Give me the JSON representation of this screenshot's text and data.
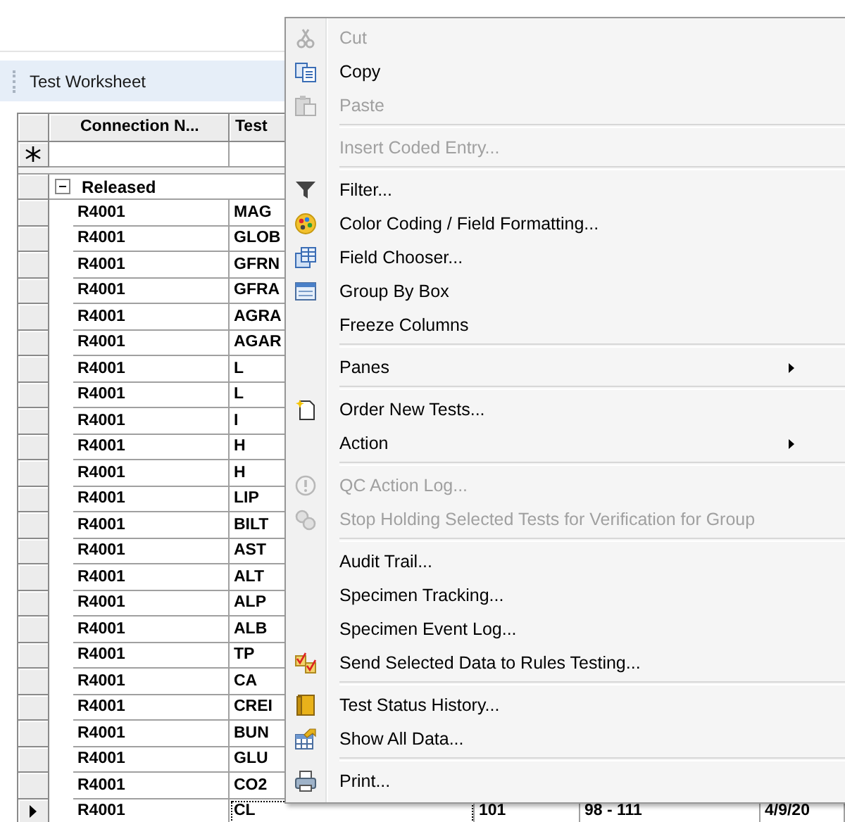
{
  "pane": {
    "title": "Test Worksheet"
  },
  "grid": {
    "columns": [
      "Connection N...",
      "Test"
    ],
    "group": {
      "label": "Released",
      "expanded": true,
      "rows": [
        {
          "connection": "R4001",
          "test": "MAG",
          "current": false
        },
        {
          "connection": "R4001",
          "test": "GLOB",
          "current": false
        },
        {
          "connection": "R4001",
          "test": "GFRN",
          "current": false
        },
        {
          "connection": "R4001",
          "test": "GFRA",
          "current": false
        },
        {
          "connection": "R4001",
          "test": "AGRA",
          "current": false
        },
        {
          "connection": "R4001",
          "test": "AGAR",
          "current": false
        },
        {
          "connection": "R4001",
          "test": "L",
          "current": false
        },
        {
          "connection": "R4001",
          "test": "L",
          "current": false
        },
        {
          "connection": "R4001",
          "test": "I",
          "current": false
        },
        {
          "connection": "R4001",
          "test": "H",
          "current": false
        },
        {
          "connection": "R4001",
          "test": "H",
          "current": false
        },
        {
          "connection": "R4001",
          "test": "LIP",
          "current": false
        },
        {
          "connection": "R4001",
          "test": "BILT",
          "current": false
        },
        {
          "connection": "R4001",
          "test": "AST",
          "current": false
        },
        {
          "connection": "R4001",
          "test": "ALT",
          "current": false
        },
        {
          "connection": "R4001",
          "test": "ALP",
          "current": false
        },
        {
          "connection": "R4001",
          "test": "ALB",
          "current": false
        },
        {
          "connection": "R4001",
          "test": "TP",
          "current": false
        },
        {
          "connection": "R4001",
          "test": "CA",
          "current": false
        },
        {
          "connection": "R4001",
          "test": "CREI",
          "current": false
        },
        {
          "connection": "R4001",
          "test": "BUN",
          "current": false
        },
        {
          "connection": "R4001",
          "test": "GLU",
          "current": false
        },
        {
          "connection": "R4001",
          "test": "CO2",
          "current": false
        },
        {
          "connection": "R4001",
          "test": "CL",
          "current": true,
          "column_3": "101",
          "column_4": "98 - 111",
          "column_5": "4/9/20"
        }
      ]
    }
  },
  "context_menu": {
    "items": [
      {
        "kind": "item",
        "label": "Cut",
        "disabled": true,
        "submenu": false
      },
      {
        "kind": "item",
        "label": "Copy",
        "disabled": false,
        "submenu": false
      },
      {
        "kind": "item",
        "label": "Paste",
        "disabled": true,
        "submenu": false
      },
      {
        "kind": "separator"
      },
      {
        "kind": "item",
        "label": "Insert Coded Entry...",
        "disabled": true,
        "submenu": false
      },
      {
        "kind": "separator"
      },
      {
        "kind": "item",
        "label": "Filter...",
        "disabled": false,
        "submenu": false
      },
      {
        "kind": "item",
        "label": "Color Coding / Field Formatting...",
        "disabled": false,
        "submenu": false
      },
      {
        "kind": "item",
        "label": "Field Chooser...",
        "disabled": false,
        "submenu": false
      },
      {
        "kind": "item",
        "label": "Group By Box",
        "disabled": false,
        "submenu": false
      },
      {
        "kind": "item",
        "label": "Freeze Columns",
        "disabled": false,
        "submenu": false
      },
      {
        "kind": "separator"
      },
      {
        "kind": "item",
        "label": "Panes",
        "disabled": false,
        "submenu": true
      },
      {
        "kind": "separator"
      },
      {
        "kind": "item",
        "label": "Order New Tests...",
        "disabled": false,
        "submenu": false
      },
      {
        "kind": "item",
        "label": "Action",
        "disabled": false,
        "submenu": true
      },
      {
        "kind": "separator"
      },
      {
        "kind": "item",
        "label": "QC Action Log...",
        "disabled": true,
        "submenu": false
      },
      {
        "kind": "item",
        "label": "Stop Holding Selected Tests for Verification for Group",
        "disabled": true,
        "submenu": false
      },
      {
        "kind": "separator"
      },
      {
        "kind": "item",
        "label": "Audit Trail...",
        "disabled": false,
        "submenu": false
      },
      {
        "kind": "item",
        "label": "Specimen Tracking...",
        "disabled": false,
        "submenu": false
      },
      {
        "kind": "item",
        "label": "Specimen Event Log...",
        "disabled": false,
        "submenu": false
      },
      {
        "kind": "item",
        "label": "Send Selected Data to Rules Testing...",
        "disabled": false,
        "submenu": false
      },
      {
        "kind": "separator"
      },
      {
        "kind": "item",
        "label": "Test Status History...",
        "disabled": false,
        "submenu": false
      },
      {
        "kind": "item",
        "label": "Show All Data...",
        "disabled": false,
        "submenu": false
      },
      {
        "kind": "separator"
      },
      {
        "kind": "item",
        "label": "Print...",
        "disabled": false,
        "submenu": false
      }
    ]
  }
}
